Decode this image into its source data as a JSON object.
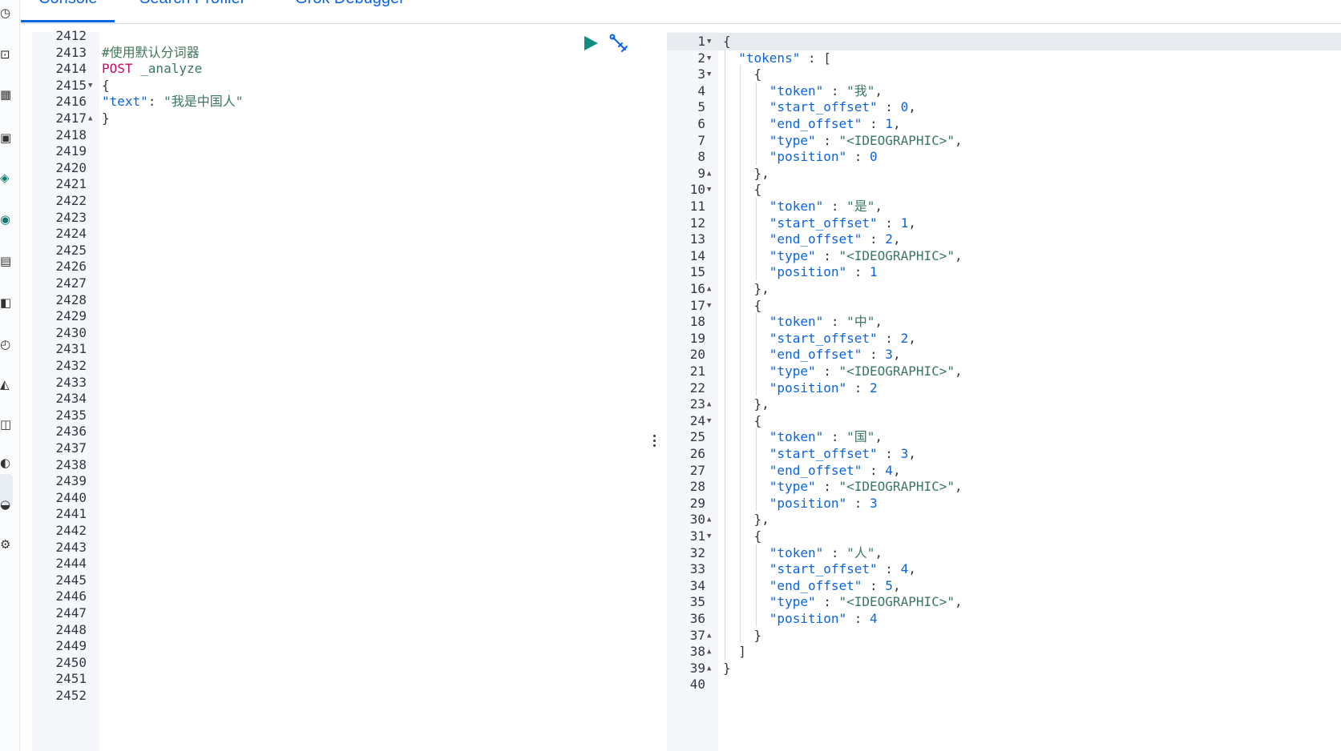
{
  "tabs": [
    {
      "label": "Console",
      "active": true
    },
    {
      "label": "Search Profiler",
      "active": false
    },
    {
      "label": "Grok Debugger",
      "active": false
    }
  ],
  "sidebar": {
    "icons": [
      "clock-icon",
      "discover-icon",
      "dashboard-icon",
      "canvas-icon",
      "maps-icon",
      "ml-icon",
      "observability-icon",
      "apm-icon",
      "uptime-icon",
      "siem-icon",
      "stack-monitoring-icon",
      "dev-tools-icon",
      "management-icon",
      "settings-icon"
    ]
  },
  "editor": {
    "line_start": 2412,
    "line_end": 2452,
    "fold_lines": {
      "2415": "down",
      "2417": "up"
    },
    "lines": {
      "2413": [
        {
          "t": "#使用默认分词器",
          "c": "comment"
        }
      ],
      "2414": [
        {
          "t": "POST",
          "c": "method"
        },
        {
          "t": " _analyze",
          "c": "str"
        }
      ],
      "2415": [
        {
          "t": "{",
          "c": "punc"
        }
      ],
      "2416": [
        {
          "t": "\"text\"",
          "c": "key"
        },
        {
          "t": ": ",
          "c": "punc"
        },
        {
          "t": "\"我是中国人\"",
          "c": "str"
        }
      ],
      "2417": [
        {
          "t": "}",
          "c": "punc"
        }
      ]
    },
    "run_button_icon": "play-icon",
    "wrench_button_icon": "wrench-icon"
  },
  "output": {
    "line_start": 1,
    "line_end": 40,
    "fold_lines": {
      "1": "down",
      "2": "down",
      "3": "down",
      "9": "up",
      "10": "down",
      "16": "up",
      "17": "down",
      "23": "up",
      "24": "down",
      "30": "up",
      "31": "down",
      "37": "up",
      "38": "up",
      "39": "up"
    },
    "text": "{\n  \"tokens\" : [\n    {\n      \"token\" : \"我\",\n      \"start_offset\" : 0,\n      \"end_offset\" : 1,\n      \"type\" : \"<IDEOGRAPHIC>\",\n      \"position\" : 0\n    },\n    {\n      \"token\" : \"是\",\n      \"start_offset\" : 1,\n      \"end_offset\" : 2,\n      \"type\" : \"<IDEOGRAPHIC>\",\n      \"position\" : 1\n    },\n    {\n      \"token\" : \"中\",\n      \"start_offset\" : 2,\n      \"end_offset\" : 3,\n      \"type\" : \"<IDEOGRAPHIC>\",\n      \"position\" : 2\n    },\n    {\n      \"token\" : \"国\",\n      \"start_offset\" : 3,\n      \"end_offset\" : 4,\n      \"type\" : \"<IDEOGRAPHIC>\",\n      \"position\" : 3\n    },\n    {\n      \"token\" : \"人\",\n      \"start_offset\" : 4,\n      \"end_offset\" : 5,\n      \"type\" : \"<IDEOGRAPHIC>\",\n      \"position\" : 4\n    }\n  ]\n}\n"
  }
}
